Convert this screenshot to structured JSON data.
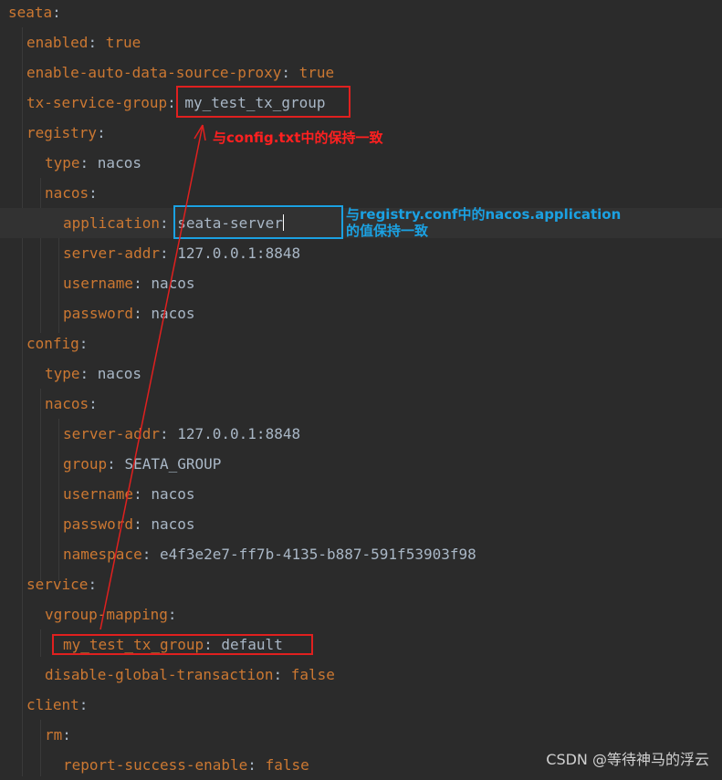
{
  "lines": [
    {
      "key": "seata",
      "sep": ":",
      "value": "",
      "vclass": "val"
    },
    {
      "key": "enabled",
      "sep": ": ",
      "value": "true",
      "vclass": "bool"
    },
    {
      "key": "enable-auto-data-source-proxy",
      "sep": ": ",
      "value": "true",
      "vclass": "bool"
    },
    {
      "key": "tx-service-group",
      "sep": ": ",
      "value": "my_test_tx_group",
      "vclass": "val"
    },
    {
      "key": "registry",
      "sep": ":",
      "value": "",
      "vclass": "val"
    },
    {
      "key": "type",
      "sep": ": ",
      "value": "nacos",
      "vclass": "val"
    },
    {
      "key": "nacos",
      "sep": ":",
      "value": "",
      "vclass": "val"
    },
    {
      "key": "application",
      "sep": ": ",
      "value": "seata-server",
      "vclass": "val"
    },
    {
      "key": "server-addr",
      "sep": ": ",
      "value": "127.0.0.1:8848",
      "vclass": "val"
    },
    {
      "key": "username",
      "sep": ": ",
      "value": "nacos",
      "vclass": "val"
    },
    {
      "key": "password",
      "sep": ": ",
      "value": "nacos",
      "vclass": "val"
    },
    {
      "key": "config",
      "sep": ":",
      "value": "",
      "vclass": "val"
    },
    {
      "key": "type",
      "sep": ": ",
      "value": "nacos",
      "vclass": "val"
    },
    {
      "key": "nacos",
      "sep": ":",
      "value": "",
      "vclass": "val"
    },
    {
      "key": "server-addr",
      "sep": ": ",
      "value": "127.0.0.1:8848",
      "vclass": "val"
    },
    {
      "key": "group",
      "sep": ": ",
      "value": "SEATA_GROUP",
      "vclass": "val"
    },
    {
      "key": "username",
      "sep": ": ",
      "value": "nacos",
      "vclass": "val"
    },
    {
      "key": "password",
      "sep": ": ",
      "value": "nacos",
      "vclass": "val"
    },
    {
      "key": "namespace",
      "sep": ": ",
      "value": "e4f3e2e7-ff7b-4135-b887-591f53903f98",
      "vclass": "val"
    },
    {
      "key": "service",
      "sep": ":",
      "value": "",
      "vclass": "val"
    },
    {
      "key": "vgroup-mapping",
      "sep": ":",
      "value": "",
      "vclass": "val"
    },
    {
      "key": "my_test_tx_group",
      "sep": ": ",
      "value": "default",
      "vclass": "val"
    },
    {
      "key": "disable-global-transaction",
      "sep": ": ",
      "value": "false",
      "vclass": "bool"
    },
    {
      "key": "client",
      "sep": ":",
      "value": "",
      "vclass": "val"
    },
    {
      "key": "rm",
      "sep": ":",
      "value": "",
      "vclass": "val"
    },
    {
      "key": "report-success-enable",
      "sep": ": ",
      "value": "false",
      "vclass": "bool"
    }
  ],
  "annotations": {
    "red_note": "与config.txt中的保持一致",
    "blue_note_line1": "与registry.conf中的nacos.application",
    "blue_note_line2": "的值保持一致"
  },
  "watermark": "CSDN @等待神马的浮云",
  "colors": {
    "background": "#2b2b2b",
    "key": "#cc7832",
    "value": "#a9b7c6",
    "red_annotation": "#e0201f",
    "blue_annotation": "#1ba1e2"
  }
}
